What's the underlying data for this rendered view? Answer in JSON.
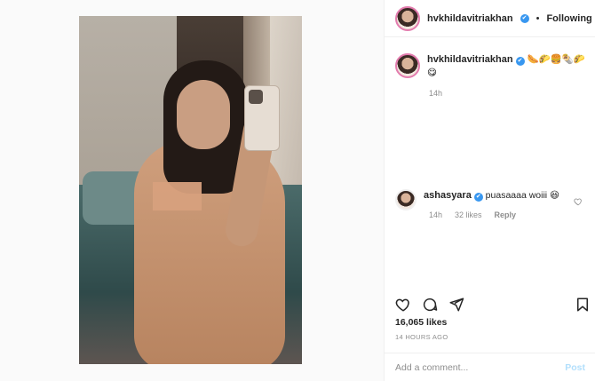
{
  "post": {
    "author": {
      "handle": "hvkhildavitriakhan",
      "verified_icon": "✔",
      "follow_label": "Following",
      "separator": "•"
    },
    "caption": {
      "handle": "hvkhildavitriakhan",
      "text": "🌭🌮🍔🌯🌮 😋",
      "time": "14h"
    },
    "comments": [
      {
        "handle": "ashasyara",
        "text": "puasaaaa woiii 😆",
        "time": "14h",
        "likes": "32 likes",
        "reply_label": "Reply"
      }
    ],
    "likes": "16,065 likes",
    "timestamp": "14 HOURS AGO",
    "comment_box": {
      "placeholder": "Add a comment...",
      "post_label": "Post"
    }
  },
  "colors": {
    "verified": "#3897f0",
    "post_button": "#b2dffc",
    "story_ring": "#e37cae"
  },
  "icons": [
    "heart-icon",
    "comment-icon",
    "share-icon",
    "bookmark-icon",
    "verified-badge-icon"
  ]
}
